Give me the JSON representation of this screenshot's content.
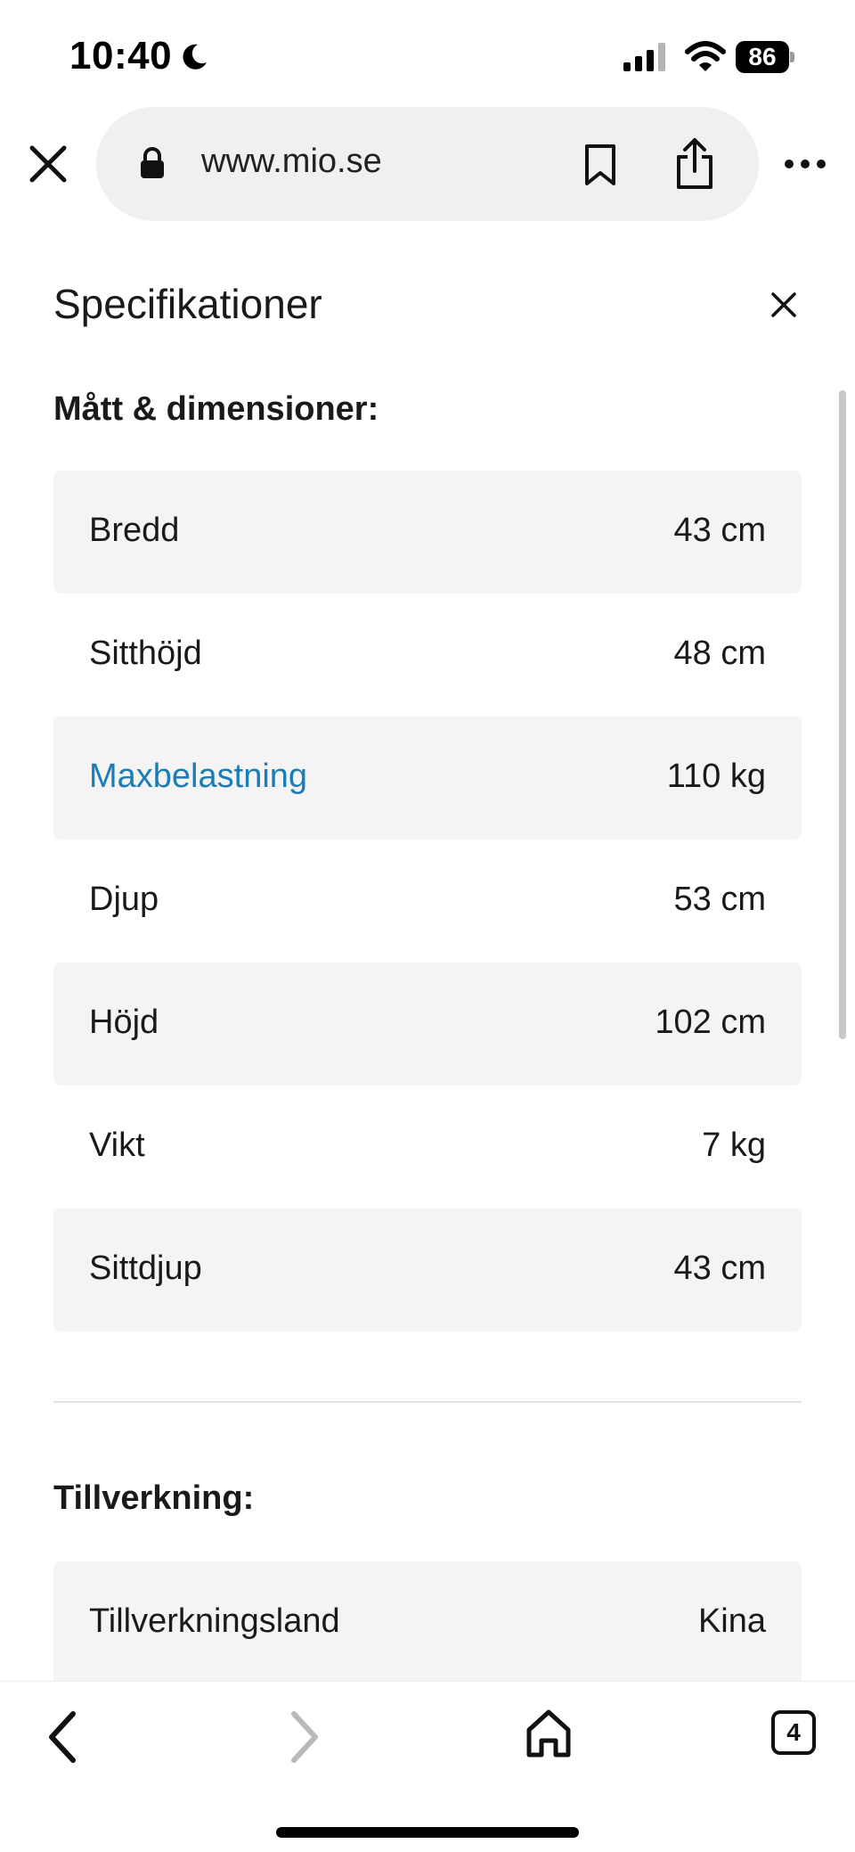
{
  "status_bar": {
    "time": "10:40",
    "battery_level": "86",
    "icons": [
      "moon-icon",
      "signal-icon",
      "wifi-icon",
      "battery-icon"
    ]
  },
  "browser": {
    "url": "www.mio.se",
    "icons": [
      "close-icon",
      "lock-icon",
      "bookmark-icon",
      "share-icon",
      "more-icon"
    ]
  },
  "panel": {
    "title": "Specifikationer",
    "sections": [
      {
        "heading": "Mått & dimensioner:",
        "rows": [
          {
            "label": "Bredd",
            "value": "43 cm"
          },
          {
            "label": "Sitthöjd",
            "value": "48 cm"
          },
          {
            "label": "Maxbelastning",
            "value": "110 kg",
            "is_link": true
          },
          {
            "label": "Djup",
            "value": "53 cm"
          },
          {
            "label": "Höjd",
            "value": "102 cm"
          },
          {
            "label": "Vikt",
            "value": "7 kg"
          },
          {
            "label": "Sittdjup",
            "value": "43 cm"
          }
        ]
      },
      {
        "heading": "Tillverkning:",
        "rows": [
          {
            "label": "Tillverkningsland",
            "value": "Kina"
          }
        ]
      }
    ]
  },
  "bottom_bar": {
    "tab_count": "4",
    "icons": [
      "back-icon",
      "forward-icon",
      "home-icon",
      "tabs-icon"
    ]
  },
  "colors": {
    "link": "#1b7db8",
    "row_shade": "#f4f4f4",
    "url_bar": "#eef0f2"
  }
}
